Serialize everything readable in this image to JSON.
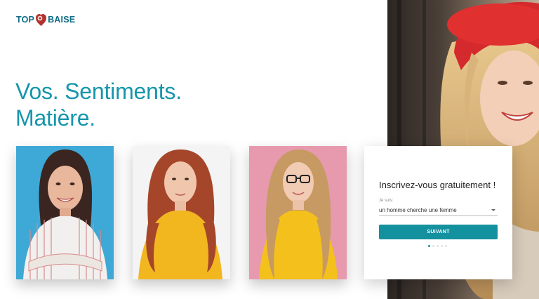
{
  "brand": {
    "logo_left": "TOP",
    "logo_right": "BAISE"
  },
  "headline": {
    "line1": "Vos. Sentiments.",
    "line2": "Matière."
  },
  "signup": {
    "title": "Inscrivez-vous gratuitement !",
    "field_label": "Je suis:",
    "select_value": "un homme cherche une femme",
    "next_label": "SUIVANT",
    "step_dots": 5,
    "active_step": 1
  },
  "colors": {
    "accent": "#1596ac",
    "button": "#14919f",
    "logo": "#0f6b86",
    "logo_mark": "#b2322c"
  }
}
